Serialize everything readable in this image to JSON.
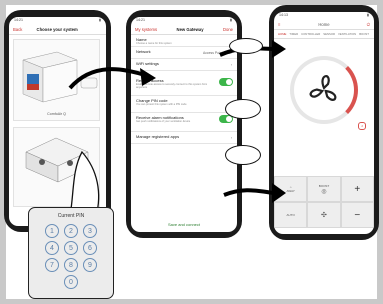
{
  "phone1": {
    "status_time": "14:21",
    "nav_back": "Back",
    "nav_title": "Choose your system",
    "unit_label": "ComfoAir Q",
    "unit_label_2": "ComfoAir Flex"
  },
  "phone2": {
    "status_time": "14:21",
    "nav_back": "My systems",
    "nav_title": "New Gateway",
    "nav_done": "Done",
    "rows": [
      {
        "title": "Name",
        "sub": "Choose a name for this system",
        "value": ""
      },
      {
        "title": "Network",
        "sub": "",
        "value": "Access Point Mode"
      },
      {
        "title": "WiFi settings",
        "sub": "",
        "value": ""
      },
      {
        "title": "Remote access",
        "sub": "Enable remote access to securely connect to this system from anywhere",
        "value": ""
      },
      {
        "title": "Change PIN code",
        "sub": "You can protect this system with a PIN code",
        "value": ""
      },
      {
        "title": "Receive alarm notifications",
        "sub": "Get push notifications of your ventilation device",
        "value": ""
      },
      {
        "title": "Manage registered apps",
        "sub": "",
        "value": ""
      }
    ],
    "save_label": "Save and connect"
  },
  "phone3": {
    "status_time": "14:13",
    "nav_title": "Home",
    "tabs": [
      "HOME",
      "TIMER",
      "CONTROLLER",
      "SENSOR",
      "VENTILATION",
      "BOOST"
    ],
    "fan_badge": "2",
    "controls": [
      {
        "label": "AWAY",
        "icon": "home-away-icon"
      },
      {
        "label": "BOOST",
        "icon": "boost-icon"
      },
      {
        "label": "+",
        "icon": "plus-icon"
      },
      {
        "label": "AUTO",
        "icon": "auto-icon"
      },
      {
        "label": "",
        "icon": "fan-icon"
      },
      {
        "label": "−",
        "icon": "minus-icon"
      }
    ]
  },
  "keypad": {
    "title": "Current PIN",
    "keys": [
      "1",
      "2",
      "3",
      "4",
      "5",
      "6",
      "7",
      "8",
      "9",
      "0"
    ]
  },
  "colors": {
    "accent_red": "#c9302c",
    "toggle_green": "#3cb54a",
    "background": "#c9c9c9"
  }
}
